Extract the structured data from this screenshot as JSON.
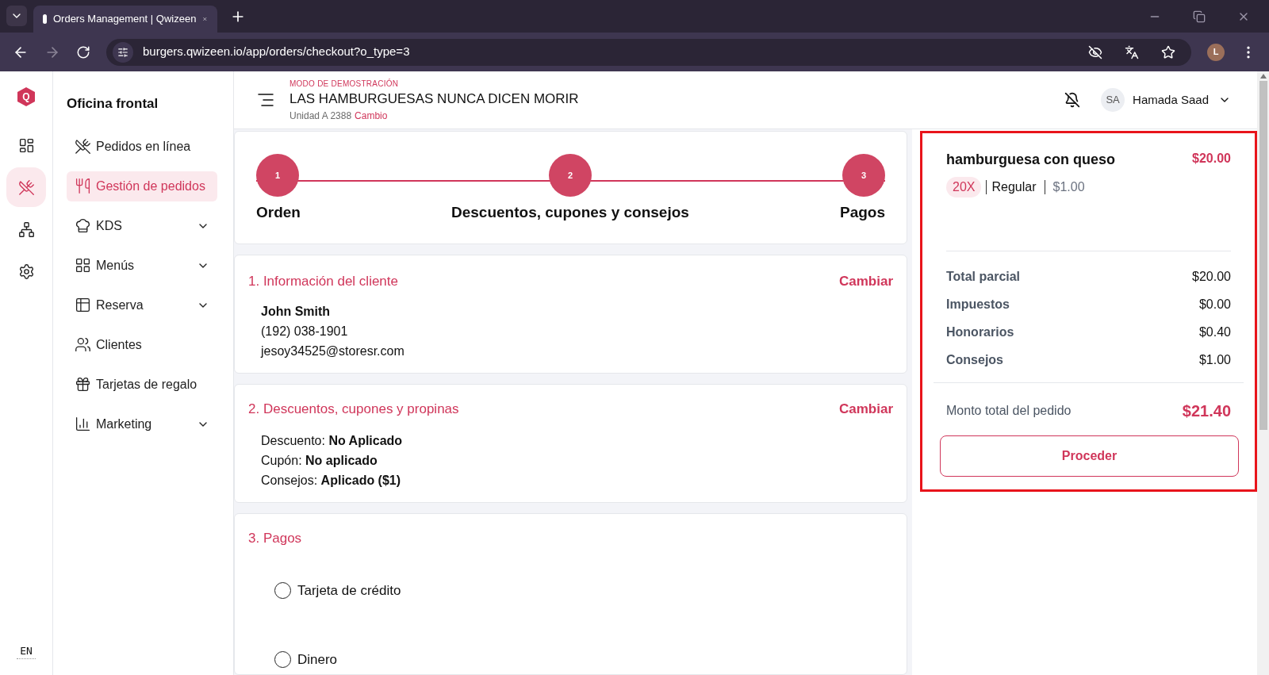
{
  "browser": {
    "tab_title": "Orders Management | Qwizeen",
    "url": "burgers.qwizeen.io/app/orders/checkout?o_type=3",
    "profile_initial": "L"
  },
  "rail": {
    "logo": "Q",
    "items": [
      {
        "kind": "dashboard",
        "selected": false
      },
      {
        "kind": "orders",
        "selected": true
      },
      {
        "kind": "network",
        "selected": false
      },
      {
        "kind": "settings",
        "selected": false
      }
    ],
    "language": "EN"
  },
  "sidebar": {
    "title": "Oficina frontal",
    "items": [
      {
        "kind": "online",
        "label": "Pedidos en línea",
        "selected": false,
        "expandable": false
      },
      {
        "kind": "orders",
        "label": "Gestión de pedidos",
        "selected": true,
        "expandable": false
      },
      {
        "kind": "kds",
        "label": "KDS",
        "selected": false,
        "expandable": true
      },
      {
        "kind": "menus",
        "label": "Menús",
        "selected": false,
        "expandable": true
      },
      {
        "kind": "reserve",
        "label": "Reserva",
        "selected": false,
        "expandable": true
      },
      {
        "kind": "clients",
        "label": "Clientes",
        "selected": false,
        "expandable": false
      },
      {
        "kind": "gift",
        "label": "Tarjetas de regalo",
        "selected": false,
        "expandable": false
      },
      {
        "kind": "marketing",
        "label": "Marketing",
        "selected": false,
        "expandable": true
      }
    ]
  },
  "header": {
    "demo_label": "MODO DE DEMOSTRACIÓN",
    "store_name": "LAS HAMBURGUESAS NUNCA DICEN MORIR",
    "unit": "Unidad A 2388",
    "unit_link": "Cambio",
    "user": {
      "initials": "SA",
      "name": "Hamada Saad"
    }
  },
  "stepper": {
    "steps": [
      {
        "number": "1",
        "label": "Orden"
      },
      {
        "number": "2",
        "label": "Descuentos, cupones y consejos"
      },
      {
        "number": "3",
        "label": "Pagos"
      }
    ]
  },
  "customer": {
    "title": "1. Información del cliente",
    "action": "Cambiar",
    "name": "John Smith",
    "phone": "(192) 038-1901",
    "email": "jesoy34525@storesr.com"
  },
  "discounts": {
    "title": "2. Descuentos, cupones y propinas",
    "action": "Cambiar",
    "lines": [
      {
        "label": "Descuento:",
        "value": "No Aplicado"
      },
      {
        "label": "Cupón:",
        "value": "No aplicado"
      },
      {
        "label": "Consejos:",
        "value": "Aplicado ($1)"
      }
    ]
  },
  "payments": {
    "title": "3. Pagos",
    "options": [
      {
        "label": "Tarjeta de crédito",
        "selected": false
      },
      {
        "label": "Dinero",
        "selected": false
      }
    ]
  },
  "summary": {
    "highlighted": true,
    "item": {
      "name": "hamburguesa con queso",
      "price": "$20.00",
      "quantity": "20X",
      "variant": "Regular",
      "extra": "$1.00"
    },
    "rows": [
      {
        "label": "Total parcial",
        "value": "$20.00"
      },
      {
        "label": "Impuestos",
        "value": "$0.00"
      },
      {
        "label": "Honorarios",
        "value": "$0.40"
      },
      {
        "label": "Consejos",
        "value": "$1.00"
      }
    ],
    "total": {
      "label": "Monto total del pedido",
      "value": "$21.40"
    },
    "button": "Proceder"
  }
}
